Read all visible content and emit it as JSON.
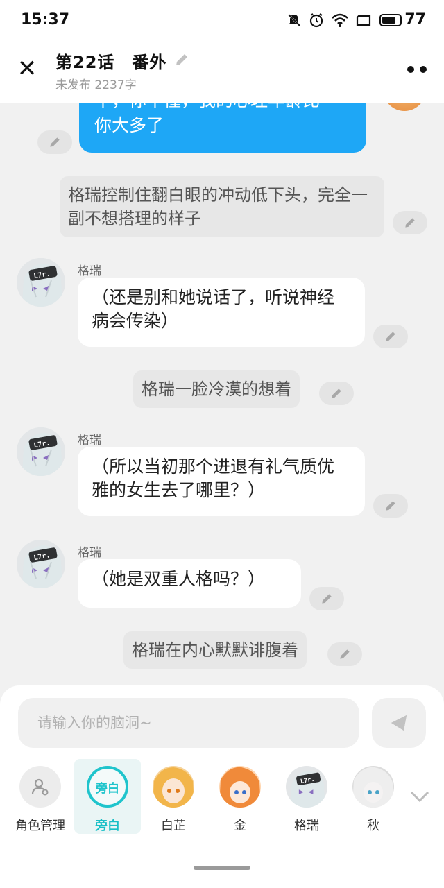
{
  "status_bar": {
    "time": "15:37",
    "icons": [
      "mute-bell-icon",
      "alarm-icon",
      "wifi-icon",
      "screen-icon"
    ],
    "battery": "77",
    "battery_level": 0.77
  },
  "header": {
    "title": "第22话　番外",
    "subtitle": "未发布 2237字",
    "icons": [
      "close-icon",
      "pencil-icon",
      "more-icon"
    ]
  },
  "chat": {
    "outgoing_partial": {
      "line1": "不，你不懂，我的心理年龄比",
      "line2": "你大多了"
    },
    "narration1": "格瑞控制住翻白眼的冲动低下头，完全一副不想搭理的样子",
    "msg1": {
      "name": "格瑞",
      "text": "（还是别和她说话了，听说神经病会传染）"
    },
    "narration2": "格瑞一脸冷漠的想着",
    "msg2": {
      "name": "格瑞",
      "text": "（所以当初那个进退有礼气质优雅的女生去了哪里？）"
    },
    "msg3": {
      "name": "格瑞",
      "text": "（她是双重人格吗？）"
    },
    "narration3": "格瑞在内心默默诽腹着"
  },
  "composer": {
    "placeholder": "请输入你的脑洞~",
    "characters": [
      {
        "label": "角色管理"
      },
      {
        "label": "旁白",
        "badge": "旁白"
      },
      {
        "label": "白芷"
      },
      {
        "label": "金"
      },
      {
        "label": "格瑞"
      },
      {
        "label": "秋"
      }
    ]
  },
  "colors": {
    "accent": "#1ea7f6",
    "selected": "#19bfc6",
    "background": "#f1f1f1"
  }
}
